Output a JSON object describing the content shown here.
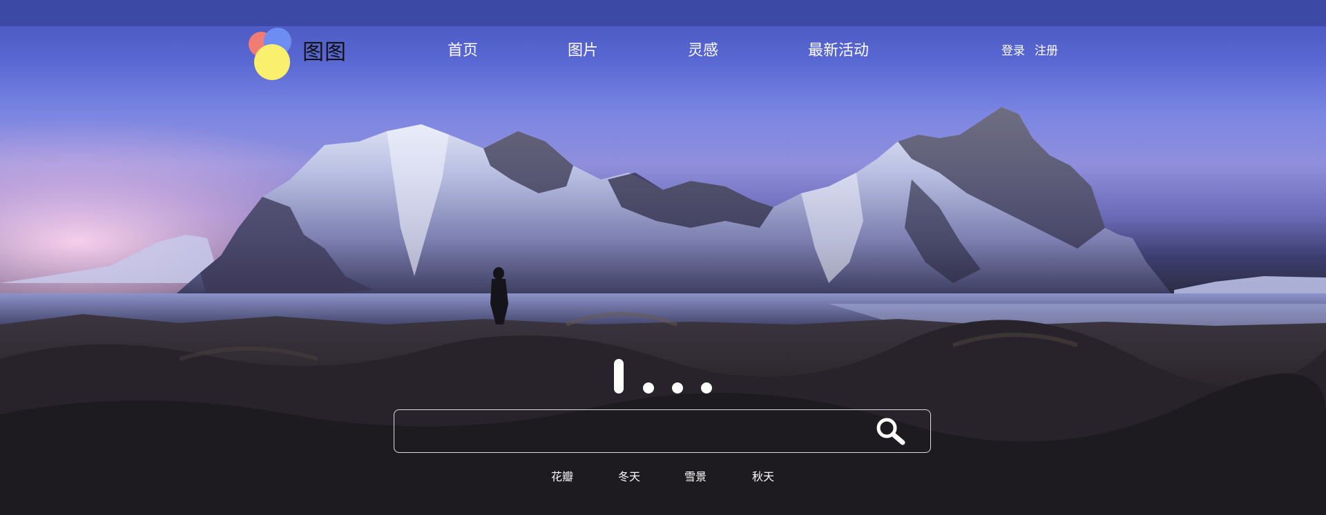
{
  "brand": {
    "name": "图图",
    "logo_colors": {
      "red": "#f07c74",
      "blue": "#6d8df2",
      "yellow": "#fbef6e"
    }
  },
  "nav": {
    "items": [
      {
        "label": "首页"
      },
      {
        "label": "图片"
      },
      {
        "label": "灵感"
      },
      {
        "label": "最新活动"
      }
    ]
  },
  "auth": {
    "login": "登录",
    "register": "注册"
  },
  "search": {
    "value": "",
    "icon": "search-icon",
    "tags": [
      "花瓣",
      "冬天",
      "雪景",
      "秋天"
    ]
  },
  "hero": {
    "loading_icon": "loading-dots-icon"
  },
  "colors": {
    "text": "#ffffff",
    "header_band": "#3c4aa6",
    "sky": "#6b79de",
    "ground": "#1e1c22"
  }
}
